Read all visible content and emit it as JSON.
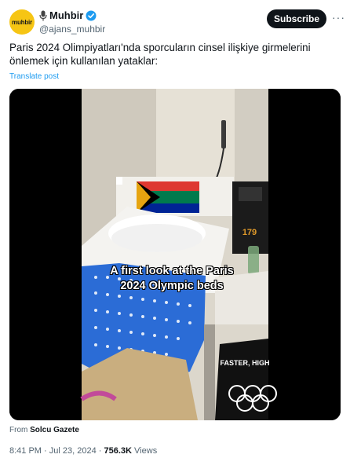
{
  "author": {
    "avatar_text": "muhbir",
    "display_name": "Muhbir",
    "handle": "@ajans_muhbir"
  },
  "actions": {
    "subscribe_label": "Subscribe",
    "more_label": "···"
  },
  "post": {
    "text": "Paris 2024 Olimpiyatları'nda sporcuların cinsel ilişkiye girmelerini önlemek için kullanılan yataklar:",
    "translate_label": "Translate post"
  },
  "media": {
    "caption_line1": "A first look at the Paris",
    "caption_line2": "2024 Olympic beds",
    "box_number": "179",
    "banner_text": "FASTER, HIGH"
  },
  "source": {
    "prefix": "From",
    "name": "Solcu Gazete"
  },
  "meta": {
    "time": "8:41 PM",
    "separator": "·",
    "date": "Jul 23, 2024",
    "views_count": "756.3K",
    "views_label": "Views"
  },
  "colors": {
    "accent": "#1d9bf0",
    "avatar_bg": "#f6c514",
    "text_primary": "#0f1419",
    "text_secondary": "#536471"
  }
}
